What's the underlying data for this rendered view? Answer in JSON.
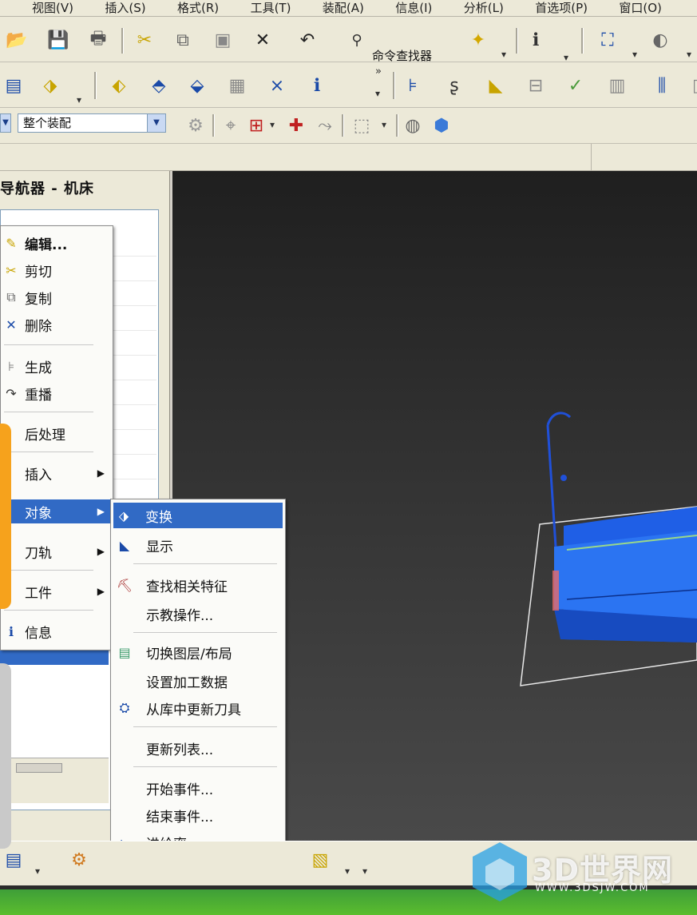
{
  "menubar": {
    "items": [
      "视图(V)",
      "插入(S)",
      "格式(R)",
      "工具(T)",
      "装配(A)",
      "信息(I)",
      "分析(L)",
      "首选项(P)",
      "窗口(O)"
    ]
  },
  "toolbar": {
    "command_finder_label": "命令查找器"
  },
  "assembly_filter": {
    "value": "整个装配"
  },
  "navigator": {
    "title": "导航器 - 机床"
  },
  "context_menu": {
    "items": [
      {
        "label": "编辑...",
        "icon": "edit-icon"
      },
      {
        "label": "剪切",
        "icon": "cut-icon"
      },
      {
        "label": "复制",
        "icon": "copy-icon"
      },
      {
        "label": "删除",
        "icon": "delete-icon"
      },
      {
        "label": "生成",
        "icon": "generate-icon"
      },
      {
        "label": "重播",
        "icon": "replay-icon"
      },
      {
        "label": "后处理",
        "icon": ""
      },
      {
        "label": "插入",
        "icon": ""
      },
      {
        "label": "对象",
        "icon": ""
      },
      {
        "label": "刀轨",
        "icon": ""
      },
      {
        "label": "工件",
        "icon": ""
      },
      {
        "label": "信息",
        "icon": "info-icon"
      }
    ],
    "highlighted": "对象"
  },
  "submenu": {
    "items": [
      {
        "label": "变换",
        "icon": "transform-icon"
      },
      {
        "label": "显示",
        "icon": "display-icon"
      },
      {
        "label": "查找相关特征",
        "icon": "find-feature-icon"
      },
      {
        "label": "示教操作...",
        "icon": ""
      },
      {
        "label": "切换图层/布局",
        "icon": "layer-icon"
      },
      {
        "label": "设置加工数据",
        "icon": ""
      },
      {
        "label": "从库中更新刀具",
        "icon": "tool-library-icon"
      },
      {
        "label": "更新列表...",
        "icon": ""
      },
      {
        "label": "开始事件...",
        "icon": ""
      },
      {
        "label": "结束事件...",
        "icon": ""
      },
      {
        "label": "进给率...",
        "icon": "feedrate-icon"
      }
    ],
    "highlighted": "变换"
  },
  "watermark": {
    "brand": "3D世界网",
    "url": "WWW.3DSJW.COM"
  },
  "colors": {
    "highlight": "#316ac5",
    "part_blue": "#1f5fe6",
    "orange_tab": "#f6a21c"
  }
}
